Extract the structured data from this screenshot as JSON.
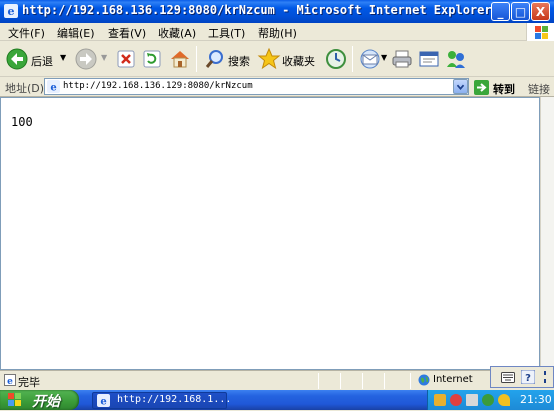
{
  "window": {
    "title": "http://192.168.136.129:8080/krNzcum - Microsoft Internet Explorer",
    "min": "_",
    "max": "□",
    "close": "X"
  },
  "menu": {
    "items": [
      "文件(F)",
      "编辑(E)",
      "查看(V)",
      "收藏(A)",
      "工具(T)",
      "帮助(H)"
    ]
  },
  "toolbar": {
    "back_label": "后退",
    "search_label": "搜索",
    "favorites_label": "收藏夹"
  },
  "address": {
    "label": "地址(D)",
    "url": "http://192.168.136.129:8080/krNzcum",
    "go_label": "转到",
    "links_label": "链接"
  },
  "content": {
    "text": "100"
  },
  "status": {
    "text": "完毕",
    "zone": "Internet"
  },
  "taskbar": {
    "start_label": "开始",
    "task_title": "http://192.168.1...",
    "clock": "21:30"
  },
  "colors": {
    "titlebar": "#0055e5",
    "taskbar": "#245edb",
    "start": "#3a9b38",
    "tray": "#1d8ad6",
    "chrome": "#ece9d8"
  }
}
